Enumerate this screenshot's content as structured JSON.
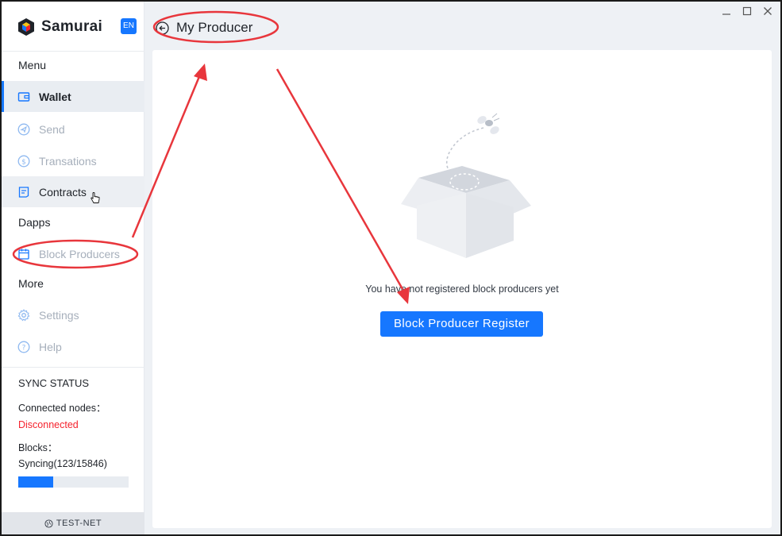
{
  "app": {
    "name": "Samurai",
    "lang": "EN"
  },
  "sidebar": {
    "menu_title": "Menu",
    "menu_items": [
      {
        "label": "Wallet",
        "icon": "wallet-icon"
      },
      {
        "label": "Send",
        "icon": "send-icon"
      },
      {
        "label": "Transations",
        "icon": "dollar-icon"
      },
      {
        "label": "Contracts",
        "icon": "contract-icon"
      }
    ],
    "dapps_title": "Dapps",
    "dapps_items": [
      {
        "label": "Block Producers",
        "icon": "calendar-icon"
      }
    ],
    "more_title": "More",
    "more_items": [
      {
        "label": "Settings",
        "icon": "gear-icon"
      },
      {
        "label": "Help",
        "icon": "help-icon"
      }
    ]
  },
  "sync": {
    "title": "SYNC STATUS",
    "nodes_label": "Connected nodes：",
    "nodes_status": "Disconnected",
    "blocks_label": "Blocks：",
    "blocks_value": "Syncing(123/15846)",
    "progress_fraction": 0.32
  },
  "network": {
    "label": "TEST-NET"
  },
  "header": {
    "title": "My Producer"
  },
  "main": {
    "empty_message": "You have not registered block producers yet",
    "register_button": "Block Producer Register"
  },
  "colors": {
    "accent": "#1677ff",
    "error": "#f5222d",
    "annotation": "#e8363c"
  }
}
